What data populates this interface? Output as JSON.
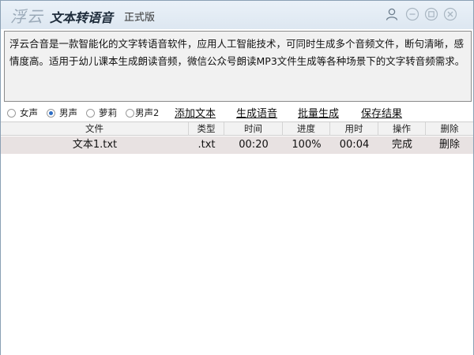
{
  "titlebar": {
    "logo_text": "浮云",
    "app_name": "文本转语音",
    "edition": "正式版"
  },
  "description": "浮云合音是一款智能化的文字转语音软件，应用人工智能技术，可同时生成多个音频文件，断句清晰，感情度高。适用于幼儿课本生成朗读音频，微信公众号朗读MP3文件生成等各种场景下的文字转音频需求。",
  "voices": [
    {
      "label": "女声",
      "selected": false
    },
    {
      "label": "男声",
      "selected": true
    },
    {
      "label": "萝莉",
      "selected": false
    },
    {
      "label": "男声2",
      "selected": false
    }
  ],
  "actions": {
    "add_text": "添加文本",
    "generate": "生成语音",
    "batch": "批量生成",
    "save": "保存结果"
  },
  "table": {
    "headers": [
      "文件",
      "类型",
      "时间",
      "进度",
      "用时",
      "操作",
      "删除"
    ],
    "rows": [
      {
        "file": "文本1.txt",
        "type": ".txt",
        "time": "00:20",
        "progress": "100%",
        "elapsed": "00:04",
        "status": "完成",
        "delete": "删除"
      }
    ]
  },
  "colors": {
    "titlebar": "#dde7f1",
    "accent": "#2b6cc4",
    "row_selected": "#e8e2e2"
  }
}
